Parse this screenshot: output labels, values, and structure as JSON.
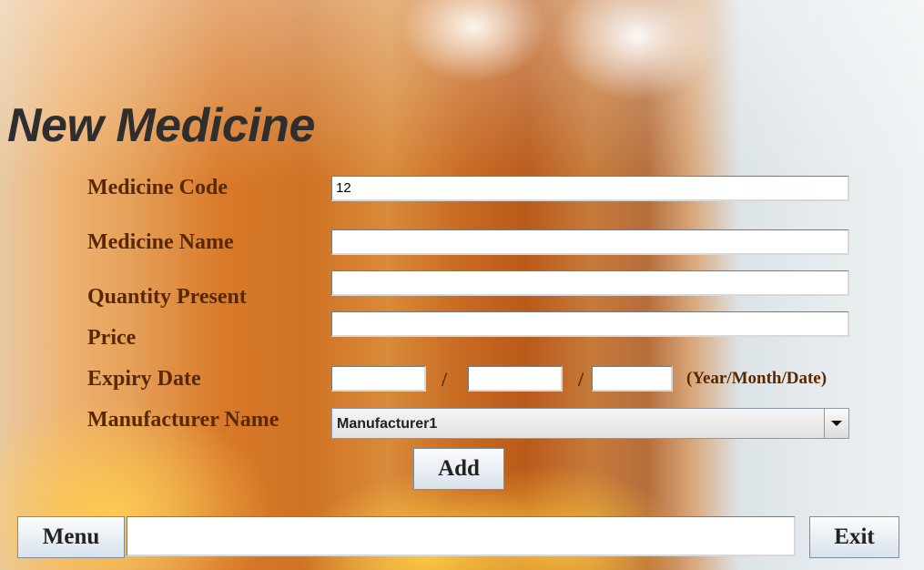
{
  "window": {
    "title": "New Medicine"
  },
  "form": {
    "medicine_code": {
      "label": "Medicine Code",
      "value": "12"
    },
    "medicine_name": {
      "label": "Medicine Name",
      "value": ""
    },
    "quantity_present": {
      "label": "Quantity Present",
      "value": ""
    },
    "price": {
      "label": "Price",
      "value": ""
    },
    "expiry_date": {
      "label": "Expiry Date",
      "year": "",
      "month": "",
      "date": "",
      "separator": "/",
      "hint": "(Year/Month/Date)"
    },
    "manufacturer_name": {
      "label": "Manufacturer Name",
      "selected": "Manufacturer1",
      "icon": "chevron-down-icon"
    },
    "add_button": {
      "label": "Add"
    }
  },
  "footer": {
    "menu_button": {
      "label": "Menu"
    },
    "status_field": {
      "value": ""
    },
    "exit_button": {
      "label": "Exit"
    }
  }
}
